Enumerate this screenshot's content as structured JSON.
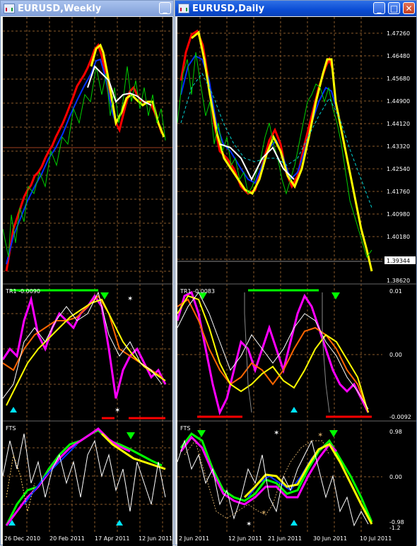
{
  "weekly": {
    "title": "EURUSD,Weekly",
    "btn_minimize": "_",
    "ind1_label": "TR1 -0.0090",
    "ind2_label": "FTS",
    "date_labels": [
      "26 Dec 2010",
      "20 Feb 2011",
      "17 Apr 2011",
      "12 Jun 2011"
    ]
  },
  "daily": {
    "title": "EURUSD,Daily",
    "btn_minimize": "_",
    "btn_maximize": "□",
    "btn_close": "✕",
    "ind1_label": "TR1 -0.0083",
    "ind2_label": "FTS",
    "price_labels": [
      "1.47260",
      "1.46480",
      "1.45680",
      "1.44900",
      "1.44120",
      "1.43320",
      "1.42540",
      "1.41760",
      "1.40980",
      "1.40180"
    ],
    "current_price": "1.39344",
    "bottom_price": "1.38620",
    "ind1_scale": [
      "0.01",
      "0.00",
      "-0.0092"
    ],
    "ind2_scale": [
      "0.98",
      "0.00",
      "-0.98",
      "-1.2"
    ],
    "date_labels": [
      "2 Jun 2011",
      "12 Jun 2011",
      "21 Jun 2011",
      "30 Jun 2011",
      "10 Jul 2011"
    ]
  },
  "colors": {
    "background": "#000000",
    "grid": "#8a5a2a",
    "bull_line": "#ff0000",
    "bear_line": "#ffff00",
    "mid_line": "#0000ff",
    "candle_green": "#00d000",
    "magenta": "#ff00ff",
    "orange": "#ff6600",
    "white": "#ffffff",
    "arrow_green": "#00ff00",
    "arrow_cyan": "#00e5ff"
  }
}
